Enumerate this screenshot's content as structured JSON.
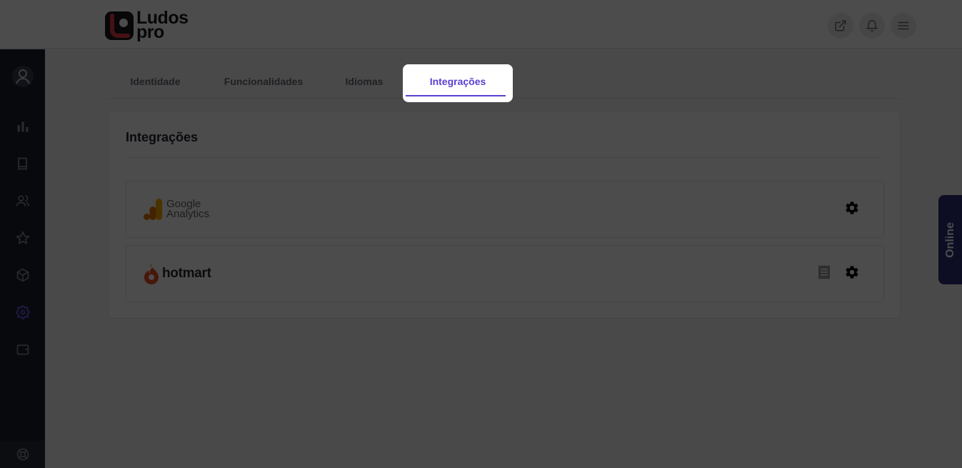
{
  "header": {
    "logo_line1": "Ludos",
    "logo_line2": "pro",
    "actions": [
      {
        "name": "external-link-icon"
      },
      {
        "name": "bell-icon"
      },
      {
        "name": "menu-icon"
      }
    ]
  },
  "sidebar": {
    "items": [
      "avatar-icon",
      "chart-icon",
      "book-icon",
      "users-icon",
      "star-icon",
      "box-icon",
      "gear-icon",
      "wallet-icon"
    ],
    "active": "gear-icon",
    "bottom": "lifebuoy-icon"
  },
  "tabs": {
    "items": [
      {
        "label": "Identidade"
      },
      {
        "label": "Funcionalidades"
      },
      {
        "label": "Idiomas"
      },
      {
        "label": "Integrações"
      }
    ],
    "active_index": 3
  },
  "card": {
    "title": "Integrações",
    "integrations": [
      {
        "name": "google-analytics",
        "logo_line1": "Google",
        "logo_line2": "Analytics",
        "actions": [
          "gear-icon"
        ]
      },
      {
        "name": "hotmart",
        "logo_text": "hotmart",
        "actions": [
          "receipt-icon",
          "gear-icon"
        ]
      }
    ]
  },
  "online_badge": "Online",
  "colors": {
    "accent": "#5b3fd0",
    "sidebar": "#1b1e2d",
    "online_badge": "#2c2f7a",
    "hotmart": "#ef4e23",
    "ga_orange": "#f9ab00",
    "ga_dark": "#e37400"
  }
}
